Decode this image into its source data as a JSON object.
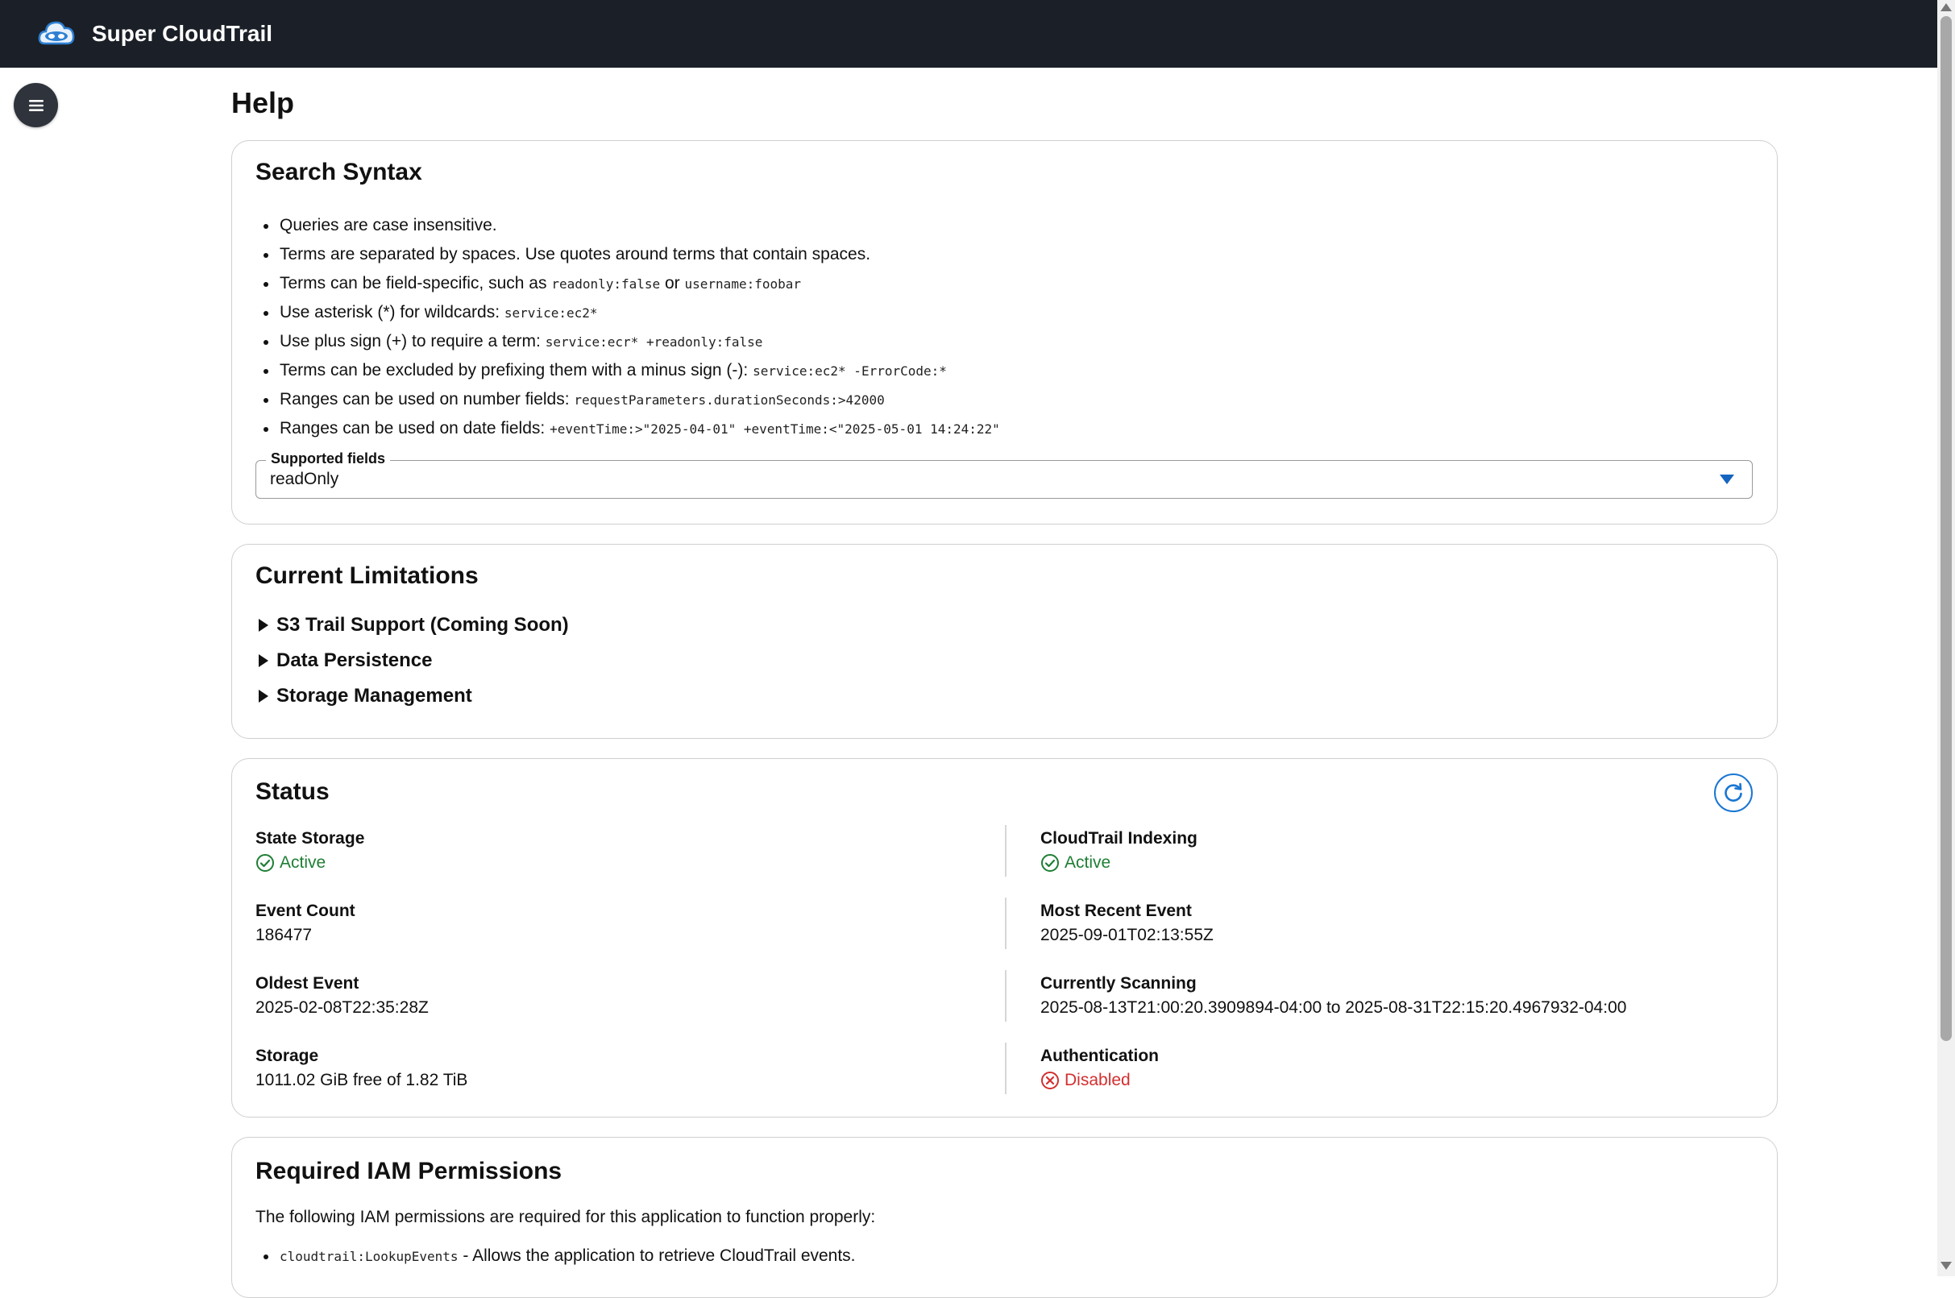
{
  "app": {
    "title": "Super CloudTrail"
  },
  "page": {
    "title": "Help"
  },
  "search_syntax": {
    "heading": "Search Syntax",
    "items": [
      {
        "text": "Queries are case insensitive."
      },
      {
        "text": "Terms are separated by spaces. Use quotes around terms that contain spaces."
      },
      {
        "text": "Terms can be field-specific, such as ",
        "code": "readonly:false",
        "mid": " or ",
        "code2": "username:foobar"
      },
      {
        "text": "Use asterisk (*) for wildcards: ",
        "code": "service:ec2*"
      },
      {
        "text": "Use plus sign (+) to require a term: ",
        "code": "service:ecr* +readonly:false"
      },
      {
        "text": "Terms can be excluded by prefixing them with a minus sign (-): ",
        "code": "service:ec2* -ErrorCode:*"
      },
      {
        "text": "Ranges can be used on number fields: ",
        "code": "requestParameters.durationSeconds:>42000"
      },
      {
        "text": "Ranges can be used on date fields: ",
        "code": "+eventTime:>\"2025-04-01\" +eventTime:<\"2025-05-01 14:24:22\""
      }
    ],
    "supported_fields": {
      "label": "Supported fields",
      "value": "readOnly"
    }
  },
  "limitations": {
    "heading": "Current Limitations",
    "items": [
      "S3 Trail Support (Coming Soon)",
      "Data Persistence",
      "Storage Management"
    ]
  },
  "status": {
    "heading": "Status",
    "left": [
      {
        "label": "State Storage",
        "value": "Active",
        "state": "ok"
      },
      {
        "label": "Event Count",
        "value": "186477"
      },
      {
        "label": "Oldest Event",
        "value": "2025-02-08T22:35:28Z"
      },
      {
        "label": "Storage",
        "value": "1011.02 GiB free of 1.82 TiB"
      }
    ],
    "right": [
      {
        "label": "CloudTrail Indexing",
        "value": "Active",
        "state": "ok"
      },
      {
        "label": "Most Recent Event",
        "value": "2025-09-01T02:13:55Z"
      },
      {
        "label": "Currently Scanning",
        "value": "2025-08-13T21:00:20.3909894-04:00 to 2025-08-31T22:15:20.4967932-04:00"
      },
      {
        "label": "Authentication",
        "value": "Disabled",
        "state": "bad"
      }
    ]
  },
  "iam": {
    "heading": "Required IAM Permissions",
    "intro": "The following IAM permissions are required for this application to function properly:",
    "items": [
      {
        "code": "cloudtrail:LookupEvents",
        "text": " - Allows the application to retrieve CloudTrail events."
      }
    ]
  },
  "colors": {
    "topbar": "#1b1f27",
    "accent": "#1976d2",
    "ok": "#1e7e34",
    "bad": "#d32f2f"
  }
}
